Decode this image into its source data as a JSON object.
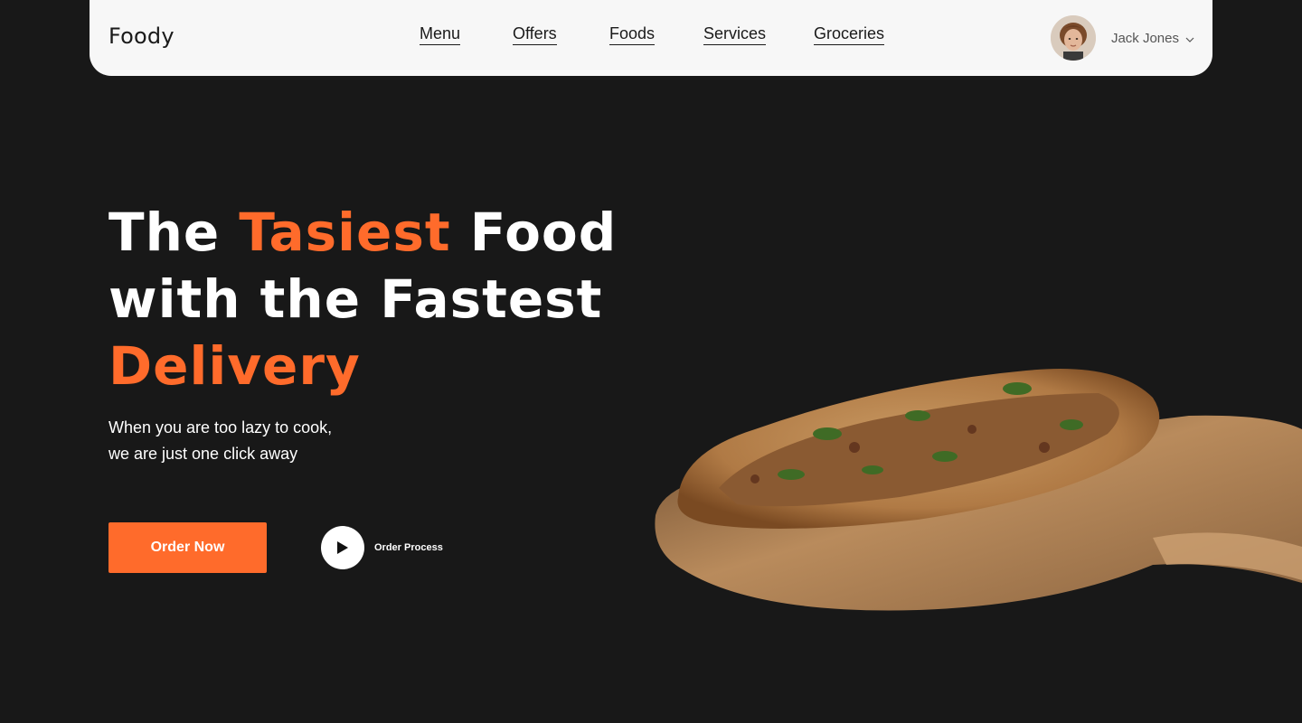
{
  "header": {
    "logo": "Foody",
    "nav": [
      "Menu",
      "Offers",
      "Foods",
      "Services",
      "Groceries"
    ],
    "user": {
      "name": "Jack Jones",
      "dropdown_icon": "chevron-down-icon"
    }
  },
  "hero": {
    "headline": {
      "line1_part1": "The ",
      "line1_accent": "Tasiest",
      "line1_part2": " Food",
      "line2": "with the Fastest",
      "line3_accent": "Delivery"
    },
    "subtext_line1": "When you are too lazy to cook,",
    "subtext_line2": "we are just one click away",
    "order_button": "Order Now",
    "process_label": "Order Process",
    "process_icon": "play-icon",
    "image": "pizza-on-peel"
  },
  "colors": {
    "background": "#181818",
    "header_bg": "#f7f7f7",
    "accent": "#ff6b2b",
    "text_light": "#ffffff",
    "text_dark": "#1a1a1a"
  }
}
